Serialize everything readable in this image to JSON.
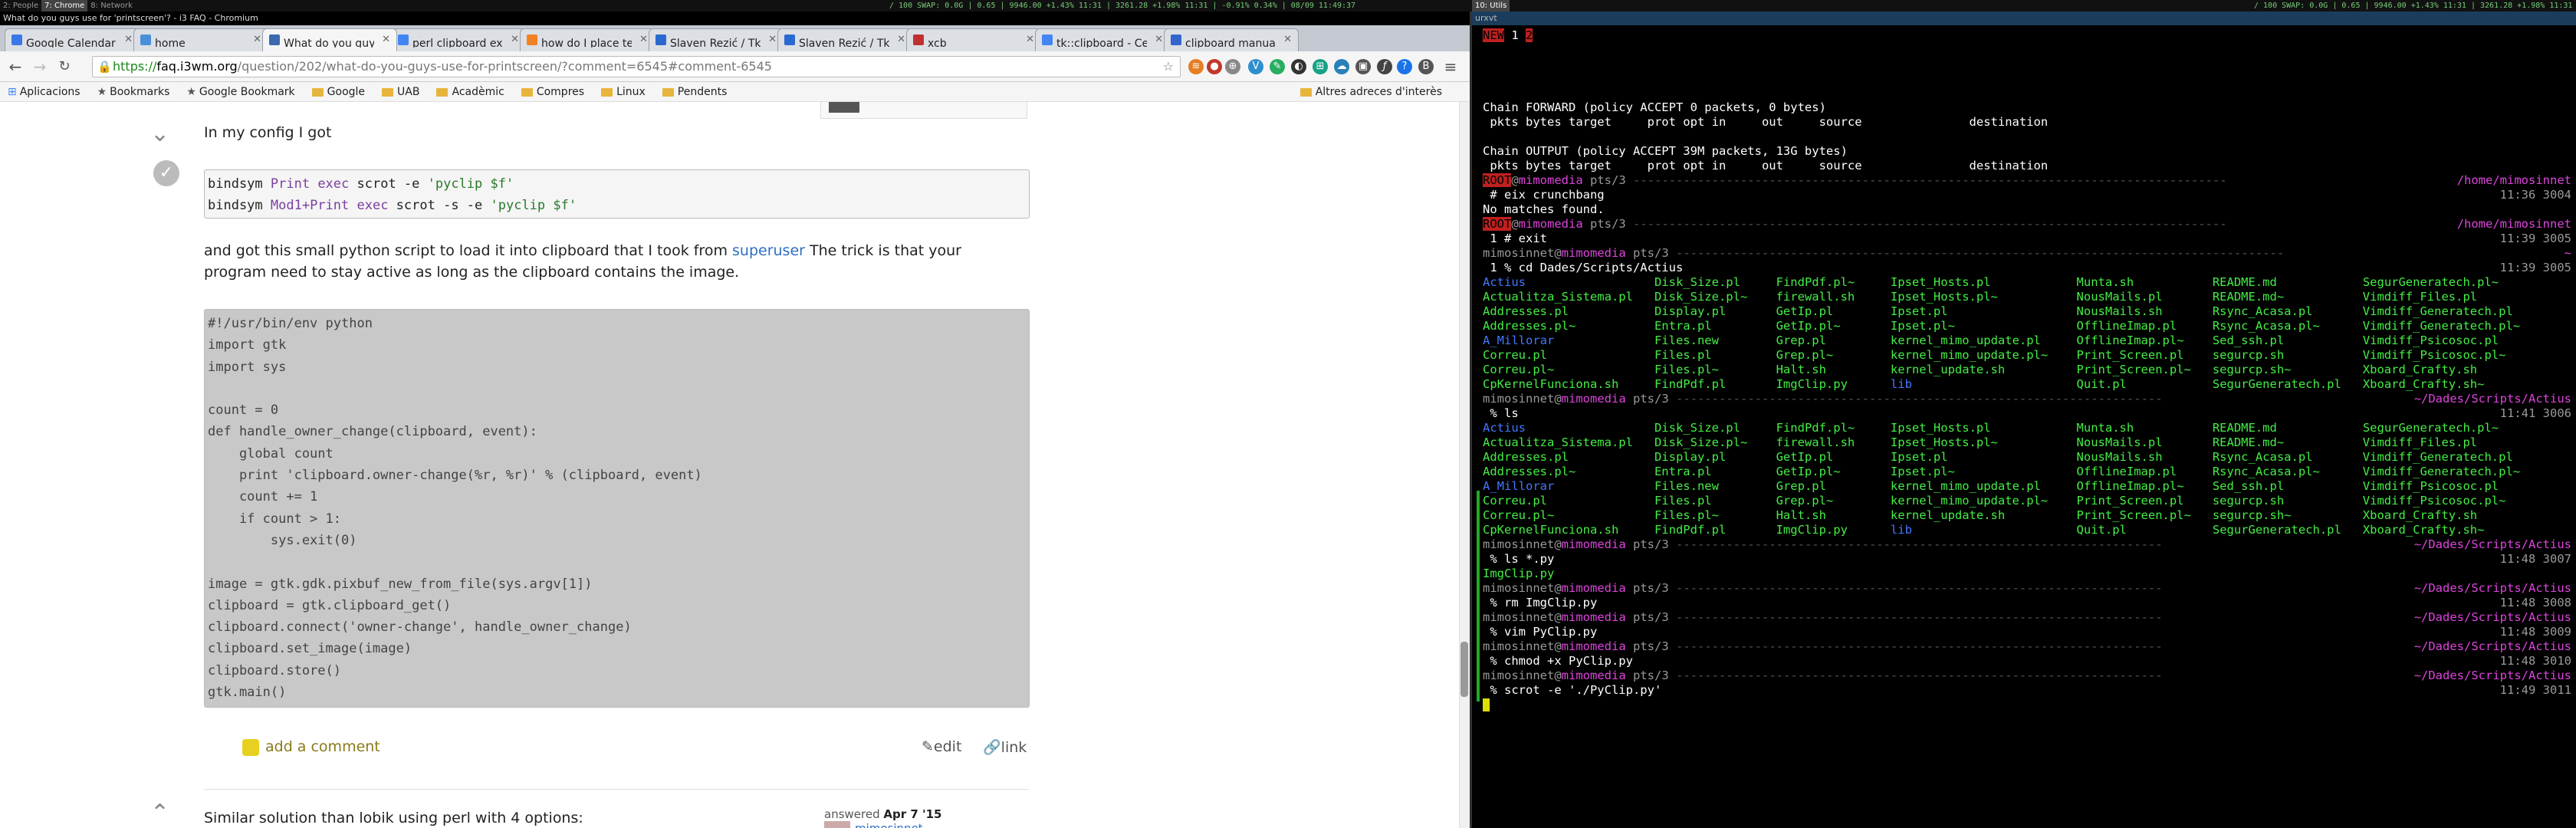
{
  "topbar": {
    "workspaces": [
      "2: People",
      "7: Chrome",
      "8: Network"
    ],
    "workspace_active_index": 1,
    "window_title": "What do you guys use for 'printscreen'? - i3 FAQ - Chromium",
    "status_left": "/ 100  SWAP: 0.0G | 0.65 | 9946.00 +1.43% 11:31 | 3261.28 +1.98% 11:31 | -0.91% 0.34% | 08/09 11:49:37",
    "workspace_right": "10: Utils",
    "status_right": "/ 100  SWAP: 0.0G | 0.65 | 9946.00 +1.43% 11:31 | 3261.28 +1.98% 11:31 | -0.61% 0.34% | 08/09 11:49:37"
  },
  "browser": {
    "tabs": [
      {
        "label": "Google Calendar",
        "color": "#3b78e7",
        "active": false
      },
      {
        "label": "home",
        "color": "#4a90d9",
        "active": false
      },
      {
        "label": "What do you guys",
        "color": "#3a6ab0",
        "active": true
      },
      {
        "label": "perl clipboard exa",
        "color": "#4285f4",
        "active": false
      },
      {
        "label": "how do I place tex",
        "color": "#f48024",
        "active": false
      },
      {
        "label": "Slaven Rezić / Tk-",
        "color": "#2a6ad0",
        "active": false
      },
      {
        "label": "Slaven Rezić / Tk-",
        "color": "#2a6ad0",
        "active": false
      },
      {
        "label": "xcb",
        "color": "#c03030",
        "active": false
      },
      {
        "label": "tk::clipboard - Cen",
        "color": "#4285f4",
        "active": false
      },
      {
        "label": "clipboard manual",
        "color": "#3366cc",
        "active": false
      }
    ],
    "url_scheme": "https://",
    "url_host": "faq.i3wm.org",
    "url_path": "/question/202/what-do-you-guys-use-for-printscreen/?comment=6545#comment-6545",
    "bookmarks": [
      "Aplicacions",
      "Bookmarks",
      "Google Bookmark",
      "Google",
      "UAB",
      "Acadèmic",
      "Compres",
      "Linux",
      "Pendents"
    ],
    "bookmarks_other": "Altres adreces d'interès"
  },
  "post": {
    "intro": "In my config I got",
    "config_code": [
      [
        {
          "t": "bindsym ",
          "c": ""
        },
        {
          "t": "Print",
          "c": "kw"
        },
        {
          "t": " exec",
          "c": "kw"
        },
        {
          "t": " scrot -e ",
          "c": ""
        },
        {
          "t": "'pyclip $f'",
          "c": "st"
        }
      ],
      [
        {
          "t": "bindsym ",
          "c": ""
        },
        {
          "t": "Mod1+Print",
          "c": "kw"
        },
        {
          "t": " exec",
          "c": "kw"
        },
        {
          "t": " scrot -s -e ",
          "c": ""
        },
        {
          "t": "'pyclip $f'",
          "c": "st"
        }
      ]
    ],
    "para_before_link": "and got this small python script to load it into clipboard that I took from ",
    "link_text": "superuser",
    "para_after_link": " The trick is that your",
    "para_line2": "program need to stay active as long as the clipboard contains the image.",
    "script_code": [
      "#!/usr/bin/env python",
      "import gtk",
      "import sys",
      "",
      "count = 0",
      "def handle_owner_change(clipboard, event):",
      "    global count",
      "    print 'clipboard.owner-change(%r, %r)' % (clipboard, event)",
      "    count += 1",
      "    if count > 1:",
      "        sys.exit(0)",
      "",
      "image = gtk.gdk.pixbuf_new_from_file(sys.argv[1])",
      "clipboard = gtk.clipboard_get()",
      "clipboard.connect('owner-change', handle_owner_change)",
      "clipboard.set_image(image)",
      "clipboard.store()",
      "gtk.main()"
    ],
    "add_comment": "add a comment",
    "edit": "edit",
    "link": "link",
    "next_answer": "Similar solution than lobik using perl with 4 options:",
    "answered_label": "answered",
    "answered_date": "Apr 7 '15",
    "answered_user": "mimosinnet"
  },
  "terminal": {
    "title": "urxvt",
    "tag_row": [
      {
        "t": "NEW",
        "c": "redbg"
      },
      {
        "t": "  1  ",
        "c": "wht"
      },
      {
        "t": " 2 ",
        "c": "redbg"
      }
    ],
    "lines": [
      {
        "segs": [],
        "right": ""
      },
      {
        "segs": [
          {
            "t": "Chain FORWARD (policy ACCEPT 0 packets, 0 bytes)",
            "c": "wht"
          }
        ],
        "right": ""
      },
      {
        "segs": [
          {
            "t": " pkts bytes target     prot opt in     out     source               destination",
            "c": "wht"
          }
        ],
        "right": ""
      },
      {
        "segs": [],
        "right": ""
      },
      {
        "segs": [
          {
            "t": "Chain OUTPUT (policy ACCEPT 39M packets, 13G bytes)",
            "c": "wht"
          }
        ],
        "right": ""
      },
      {
        "segs": [
          {
            "t": " pkts bytes target     prot opt in     out     source               destination",
            "c": "wht"
          }
        ],
        "right": ""
      },
      {
        "segs": [
          {
            "t": "ROOT",
            "c": "redbg"
          },
          {
            "t": "@",
            "c": "gry"
          },
          {
            "t": "mimomedia",
            "c": "mag"
          },
          {
            "t": " pts/3 ",
            "c": "gry"
          },
          {
            "t": "-----------------------------------------------------------------------------------",
            "c": "sep"
          }
        ],
        "right": "/home/mimosinnet",
        "rc": "mag"
      },
      {
        "segs": [
          {
            "t": " # eix crunchbang",
            "c": "wht"
          }
        ],
        "right": "11:36 3004",
        "rc": "gry"
      },
      {
        "segs": [
          {
            "t": "No matches found.",
            "c": "wht"
          }
        ],
        "right": ""
      },
      {
        "segs": [
          {
            "t": "ROOT",
            "c": "redbg"
          },
          {
            "t": "@",
            "c": "gry"
          },
          {
            "t": "mimomedia",
            "c": "mag"
          },
          {
            "t": " pts/3 ",
            "c": "gry"
          },
          {
            "t": "-----------------------------------------------------------------------------------",
            "c": "sep"
          }
        ],
        "right": "/home/mimosinnet",
        "rc": "mag"
      },
      {
        "segs": [
          {
            "t": " 1 # exit",
            "c": "wht"
          }
        ],
        "right": "11:39 3005",
        "rc": "gry"
      },
      {
        "segs": [
          {
            "t": "mimosinnet",
            "c": "gry"
          },
          {
            "t": "@",
            "c": "gry"
          },
          {
            "t": "mimomedia",
            "c": "mag"
          },
          {
            "t": " pts/3 ",
            "c": "gry"
          },
          {
            "t": "-------------------------------------------------------------------------------------",
            "c": "sep"
          }
        ],
        "right": "~",
        "rc": "mag"
      },
      {
        "segs": [
          {
            "t": " 1 % cd Dades/Scripts/Actius",
            "c": "wht"
          }
        ],
        "right": "11:39 3005",
        "rc": "gry"
      },
      {
        "segs": [
          {
            "t": "Actius",
            "c": "blu"
          },
          {
            "t": "                  Disk_Size.pl     FindPdf.pl~     Ipset_Hosts.pl            Munta.sh           README.md            SegurGeneratech.pl~",
            "c": "grn"
          }
        ],
        "right": ""
      },
      {
        "segs": [
          {
            "t": "Actualitza_Sistema.pl   Disk_Size.pl~    firewall.sh     Ipset_Hosts.pl~           NousMails.pl       README.md~           Vimdiff_Files.pl",
            "c": "grn"
          }
        ],
        "right": ""
      },
      {
        "segs": [
          {
            "t": "Addresses.pl            Display.pl       GetIp.pl        Ipset.pl                  NousMails.sh       Rsync_Acasa.pl       Vimdiff_Generatech.pl",
            "c": "grn"
          }
        ],
        "right": ""
      },
      {
        "segs": [
          {
            "t": "Addresses.pl~           Entra.pl         GetIp.pl~       Ipset.pl~                 OfflineImap.pl     Rsync_Acasa.pl~      Vimdiff_Generatech.pl~",
            "c": "grn"
          }
        ],
        "right": ""
      },
      {
        "segs": [
          {
            "t": "A_Millorar",
            "c": "blu"
          },
          {
            "t": "              Files.new        Grep.pl         kernel_mimo_update.pl     OfflineImap.pl~    Sed_ssh.pl           Vimdiff_Psicosoc.pl",
            "c": "grn"
          }
        ],
        "right": ""
      },
      {
        "segs": [
          {
            "t": "Correu.pl               Files.pl         Grep.pl~        kernel_mimo_update.pl~    Print_Screen.pl    segurcp.sh           Vimdiff_Psicosoc.pl~",
            "c": "grn"
          }
        ],
        "right": ""
      },
      {
        "segs": [
          {
            "t": "Correu.pl~              Files.pl~        Halt.sh         kernel_update.sh          Print_Screen.pl~   segurcp.sh~          Xboard_Crafty.sh",
            "c": "grn"
          }
        ],
        "right": ""
      },
      {
        "segs": [
          {
            "t": "CpKernelFunciona.sh     FindPdf.pl       ImgClip.py      ",
            "c": "grn"
          },
          {
            "t": "lib",
            "c": "blu"
          },
          {
            "t": "                       Quit.pl            SegurGeneratech.pl   Xboard_Crafty.sh~",
            "c": "grn"
          }
        ],
        "right": ""
      },
      {
        "segs": [
          {
            "t": "mimosinnet",
            "c": "gry"
          },
          {
            "t": "@",
            "c": "gry"
          },
          {
            "t": "mimomedia",
            "c": "mag"
          },
          {
            "t": " pts/3 ",
            "c": "gry"
          },
          {
            "t": "--------------------------------------------------------------------",
            "c": "sep"
          }
        ],
        "right": "~/Dades/Scripts/Actius",
        "rc": "mag"
      },
      {
        "segs": [
          {
            "t": " % ls",
            "c": "wht"
          }
        ],
        "right": "11:41 3006",
        "rc": "gry"
      },
      {
        "segs": [
          {
            "t": "Actius",
            "c": "blu"
          },
          {
            "t": "                  Disk_Size.pl     FindPdf.pl~     Ipset_Hosts.pl            Munta.sh           README.md            SegurGeneratech.pl~",
            "c": "grn"
          }
        ],
        "right": ""
      },
      {
        "segs": [
          {
            "t": "Actualitza_Sistema.pl   Disk_Size.pl~    firewall.sh     Ipset_Hosts.pl~           NousMails.pl       README.md~           Vimdiff_Files.pl",
            "c": "grn"
          }
        ],
        "right": ""
      },
      {
        "segs": [
          {
            "t": "Addresses.pl            Display.pl       GetIp.pl        Ipset.pl                  NousMails.sh       Rsync_Acasa.pl       Vimdiff_Generatech.pl",
            "c": "grn"
          }
        ],
        "right": ""
      },
      {
        "segs": [
          {
            "t": "Addresses.pl~           Entra.pl         GetIp.pl~       Ipset.pl~                 OfflineImap.pl     Rsync_Acasa.pl~      Vimdiff_Generatech.pl~",
            "c": "grn"
          }
        ],
        "right": ""
      },
      {
        "segs": [
          {
            "t": "A_Millorar",
            "c": "blu"
          },
          {
            "t": "              Files.new        Grep.pl         kernel_mimo_update.pl     OfflineImap.pl~    Sed_ssh.pl           Vimdiff_Psicosoc.pl",
            "c": "grn"
          }
        ],
        "right": ""
      },
      {
        "segs": [
          {
            "t": "Correu.pl               Files.pl         Grep.pl~        kernel_mimo_update.pl~    Print_Screen.pl    segurcp.sh           Vimdiff_Psicosoc.pl~",
            "c": "grn"
          }
        ],
        "right": ""
      },
      {
        "segs": [
          {
            "t": "Correu.pl~              Files.pl~        Halt.sh         kernel_update.sh          Print_Screen.pl~   segurcp.sh~          Xboard_Crafty.sh",
            "c": "grn"
          }
        ],
        "right": ""
      },
      {
        "segs": [
          {
            "t": "CpKernelFunciona.sh     FindPdf.pl       ImgClip.py      ",
            "c": "grn"
          },
          {
            "t": "lib",
            "c": "blu"
          },
          {
            "t": "                       Quit.pl            SegurGeneratech.pl   Xboard_Crafty.sh~",
            "c": "grn"
          }
        ],
        "right": ""
      },
      {
        "segs": [
          {
            "t": "mimosinnet",
            "c": "gry"
          },
          {
            "t": "@",
            "c": "gry"
          },
          {
            "t": "mimomedia",
            "c": "mag"
          },
          {
            "t": " pts/3 ",
            "c": "gry"
          },
          {
            "t": "--------------------------------------------------------------------",
            "c": "sep"
          }
        ],
        "right": "~/Dades/Scripts/Actius",
        "rc": "mag"
      },
      {
        "segs": [
          {
            "t": " % ls *.py",
            "c": "wht"
          }
        ],
        "right": "11:48 3007",
        "rc": "gry"
      },
      {
        "segs": [
          {
            "t": "ImgClip.py",
            "c": "grn"
          }
        ],
        "right": ""
      },
      {
        "segs": [
          {
            "t": "mimosinnet",
            "c": "gry"
          },
          {
            "t": "@",
            "c": "gry"
          },
          {
            "t": "mimomedia",
            "c": "mag"
          },
          {
            "t": " pts/3 ",
            "c": "gry"
          },
          {
            "t": "--------------------------------------------------------------------",
            "c": "sep"
          }
        ],
        "right": "~/Dades/Scripts/Actius",
        "rc": "mag"
      },
      {
        "segs": [
          {
            "t": " % rm ImgClip.py",
            "c": "wht"
          }
        ],
        "right": "11:48 3008",
        "rc": "gry"
      },
      {
        "segs": [
          {
            "t": "mimosinnet",
            "c": "gry"
          },
          {
            "t": "@",
            "c": "gry"
          },
          {
            "t": "mimomedia",
            "c": "mag"
          },
          {
            "t": " pts/3 ",
            "c": "gry"
          },
          {
            "t": "--------------------------------------------------------------------",
            "c": "sep"
          }
        ],
        "right": "~/Dades/Scripts/Actius",
        "rc": "mag"
      },
      {
        "segs": [
          {
            "t": " % vim PyClip.py",
            "c": "wht"
          }
        ],
        "right": "11:48 3009",
        "rc": "gry"
      },
      {
        "segs": [
          {
            "t": "mimosinnet",
            "c": "gry"
          },
          {
            "t": "@",
            "c": "gry"
          },
          {
            "t": "mimomedia",
            "c": "mag"
          },
          {
            "t": " pts/3 ",
            "c": "gry"
          },
          {
            "t": "--------------------------------------------------------------------",
            "c": "sep"
          }
        ],
        "right": "~/Dades/Scripts/Actius",
        "rc": "mag"
      },
      {
        "segs": [
          {
            "t": " % chmod +x PyClip.py",
            "c": "wht"
          }
        ],
        "right": "11:48 3010",
        "rc": "gry"
      },
      {
        "segs": [
          {
            "t": "mimosinnet",
            "c": "gry"
          },
          {
            "t": "@",
            "c": "gry"
          },
          {
            "t": "mimomedia",
            "c": "mag"
          },
          {
            "t": " pts/3 ",
            "c": "gry"
          },
          {
            "t": "--------------------------------------------------------------------",
            "c": "sep"
          }
        ],
        "right": "~/Dades/Scripts/Actius",
        "rc": "mag"
      },
      {
        "segs": [
          {
            "t": " % scrot -e './PyClip.py'",
            "c": "wht"
          }
        ],
        "right": "11:49 3011",
        "rc": "gry"
      }
    ]
  }
}
